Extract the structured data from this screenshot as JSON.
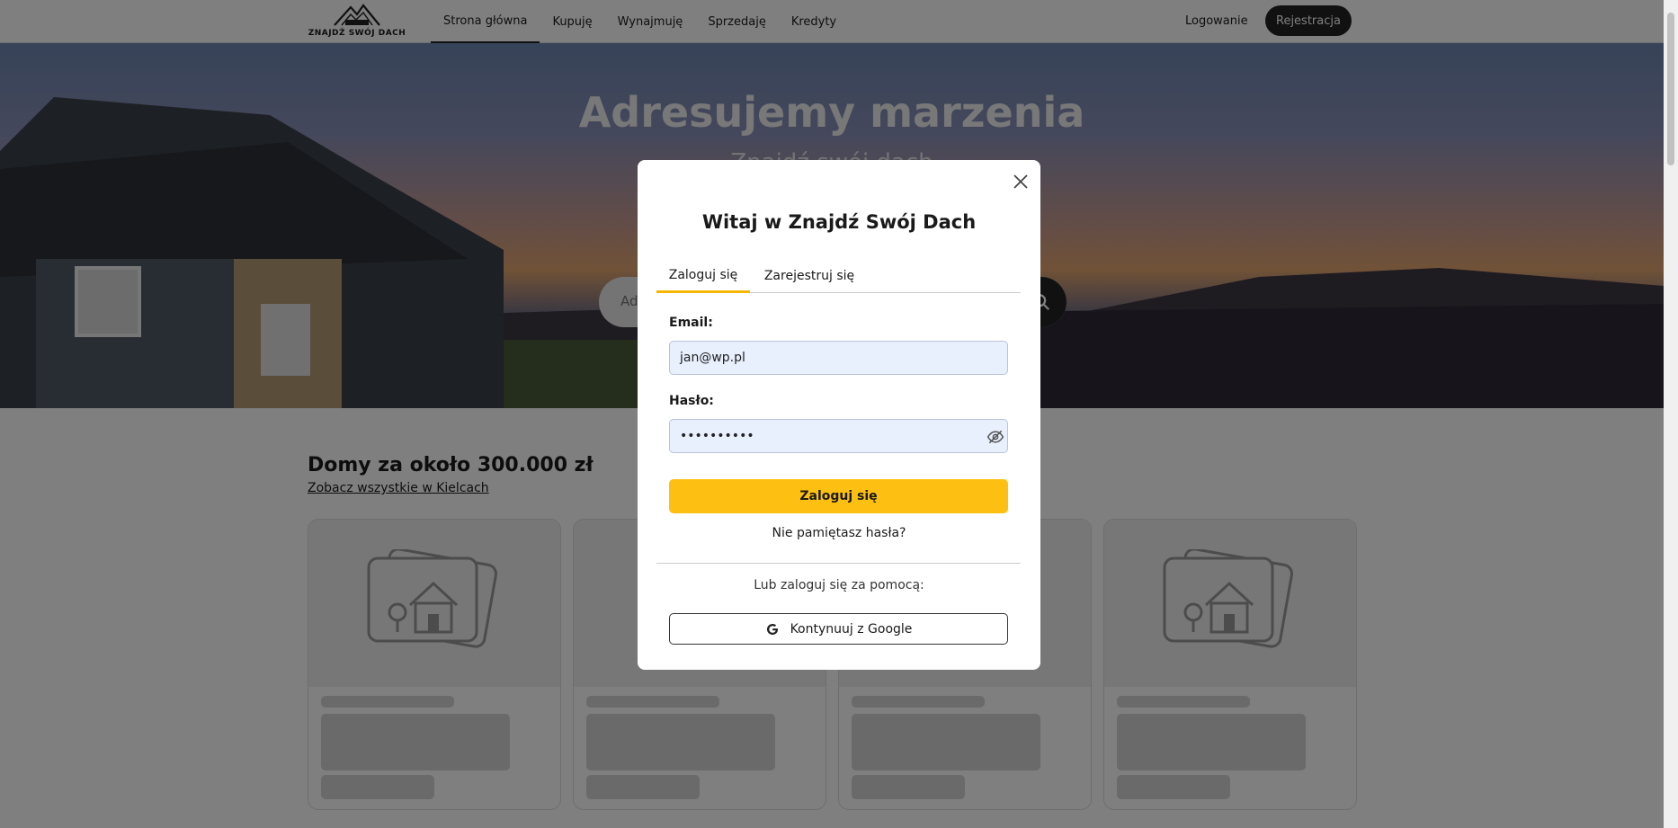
{
  "header": {
    "logo_text": "ZNAJDŹ SWÓJ DACH",
    "nav": [
      {
        "label": "Strona główna",
        "active": true
      },
      {
        "label": "Kupuję",
        "active": false
      },
      {
        "label": "Wynajmuję",
        "active": false
      },
      {
        "label": "Sprzedaję",
        "active": false
      },
      {
        "label": "Kredyty",
        "active": false
      }
    ],
    "login_label": "Logowanie",
    "register_label": "Rejestracja"
  },
  "hero": {
    "title": "Adresujemy marzenia",
    "subtitle": "Znajdź swój dach",
    "search_placeholder": "Adres"
  },
  "listings": {
    "title": "Domy za około 300.000 zł",
    "see_all_link": "Zobacz wszystkie w Kielcach",
    "card_count": 4
  },
  "modal": {
    "title": "Witaj w Znajdź Swój Dach",
    "tabs": [
      {
        "label": "Zaloguj się",
        "active": true
      },
      {
        "label": "Zarejestruj się",
        "active": false
      }
    ],
    "email_label": "Email:",
    "email_value": "jan@wp.pl",
    "password_label": "Hasło:",
    "password_value": "••••••••••",
    "submit_label": "Zaloguj się",
    "forgot_label": "Nie pamiętasz hasła?",
    "or_label": "Lub zaloguj się za pomocą:",
    "google_label": "Kontynuuj z Google"
  },
  "colors": {
    "accent": "#fdc012",
    "dark": "#222222",
    "field_bg": "#e8f0fe"
  }
}
